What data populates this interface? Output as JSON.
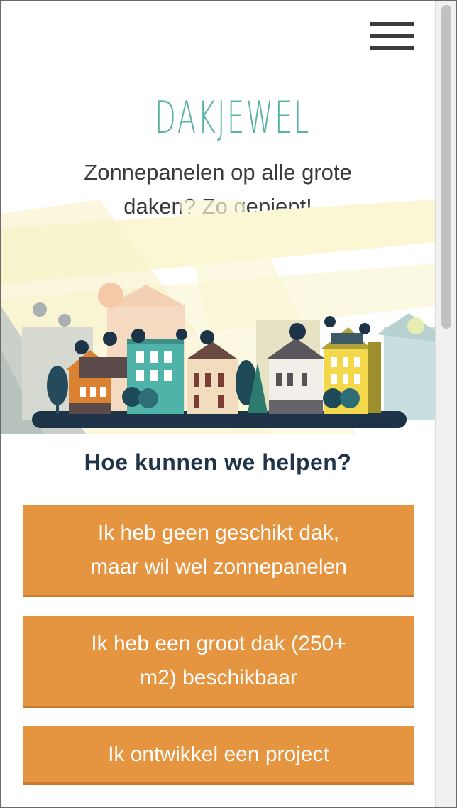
{
  "header": {
    "logo_text": "DAKJEWEL",
    "tagline_line1": "Zonnepanelen op alle grote",
    "tagline_line2": "daken? Zo gepiept!"
  },
  "main": {
    "section_title": "Hoe kunnen we helpen?",
    "buttons": [
      {
        "line1": "Ik heb geen geschikt dak,",
        "line2": "maar wil wel zonnepanelen"
      },
      {
        "line1": "Ik heb een groot dak (250+",
        "line2": "m2) beschikbaar"
      },
      {
        "line1": "Ik ontwikkel een project",
        "line2": ""
      }
    ]
  },
  "colors": {
    "accent_orange": "#e5943f",
    "logo_teal": "#58b3a5",
    "title_navy": "#1f3448"
  },
  "icons": {
    "menu": "hamburger-menu-icon"
  }
}
